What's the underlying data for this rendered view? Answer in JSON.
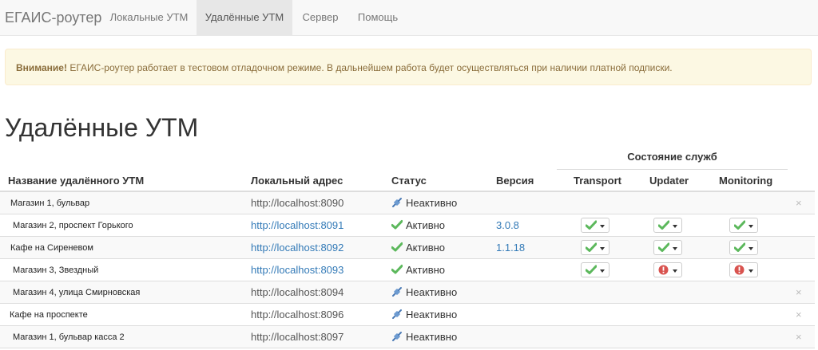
{
  "navbar": {
    "brand": "ЕГАИС-роутер",
    "items": [
      {
        "label": "Локальные УТМ",
        "active": false
      },
      {
        "label": "Удалённые УТМ",
        "active": true
      },
      {
        "label": "Сервер",
        "active": false
      },
      {
        "label": "Помощь",
        "active": false
      }
    ]
  },
  "alert": {
    "strong": "Внимание!",
    "text": " ЕГАИС-роутер работает в тестовом отладочном режиме. В дальнейшем работа будет осуществляться при наличии платной подписки."
  },
  "page_title": "Удалённые УТМ",
  "table": {
    "group_header": "Состояние служб",
    "headers": {
      "name": "Название удалённого УТМ",
      "address": "Локальный адрес",
      "status": "Статус",
      "version": "Версия",
      "transport": "Transport",
      "updater": "Updater",
      "monitoring": "Monitoring"
    },
    "remove_symbol": "×",
    "colors": {
      "ok": "#5cb85c",
      "error": "#d9534f",
      "link": "#337ab7"
    },
    "rows": [
      {
        "name": "Магазин 1, бульвар",
        "address": "http://localhost:8090",
        "linked": false,
        "status": "Неактивно",
        "status_icon": "plug-icon",
        "version": "",
        "services": null,
        "removable": true
      },
      {
        "name": "Магазин 2, проспект Горького",
        "address": "http://localhost:8091",
        "linked": true,
        "status": "Активно",
        "status_icon": "check-icon",
        "version": "3.0.8",
        "services": [
          "ok",
          "ok",
          "ok"
        ],
        "removable": false
      },
      {
        "name": "Кафе на Сиреневом",
        "address": "http://localhost:8092",
        "linked": true,
        "status": "Активно",
        "status_icon": "check-icon",
        "version": "1.1.18",
        "services": [
          "ok",
          "ok",
          "ok"
        ],
        "removable": false
      },
      {
        "name": "Магазин 3, Звездный",
        "address": "http://localhost:8093",
        "linked": true,
        "status": "Активно",
        "status_icon": "check-icon",
        "version": "",
        "services": [
          "ok",
          "error",
          "error"
        ],
        "removable": false
      },
      {
        "name": "Магазин 4, улица Смирновская",
        "address": "http://localhost:8094",
        "linked": false,
        "status": "Неактивно",
        "status_icon": "plug-icon",
        "version": "",
        "services": null,
        "removable": true
      },
      {
        "name": "Кафе на проспекте",
        "address": "http://localhost:8096",
        "linked": false,
        "status": "Неактивно",
        "status_icon": "plug-icon",
        "version": "",
        "services": null,
        "removable": true
      },
      {
        "name": "Магазин 1, бульвар касса 2",
        "address": "http://localhost:8097",
        "linked": false,
        "status": "Неактивно",
        "status_icon": "plug-icon",
        "version": "",
        "services": null,
        "removable": true
      }
    ]
  }
}
